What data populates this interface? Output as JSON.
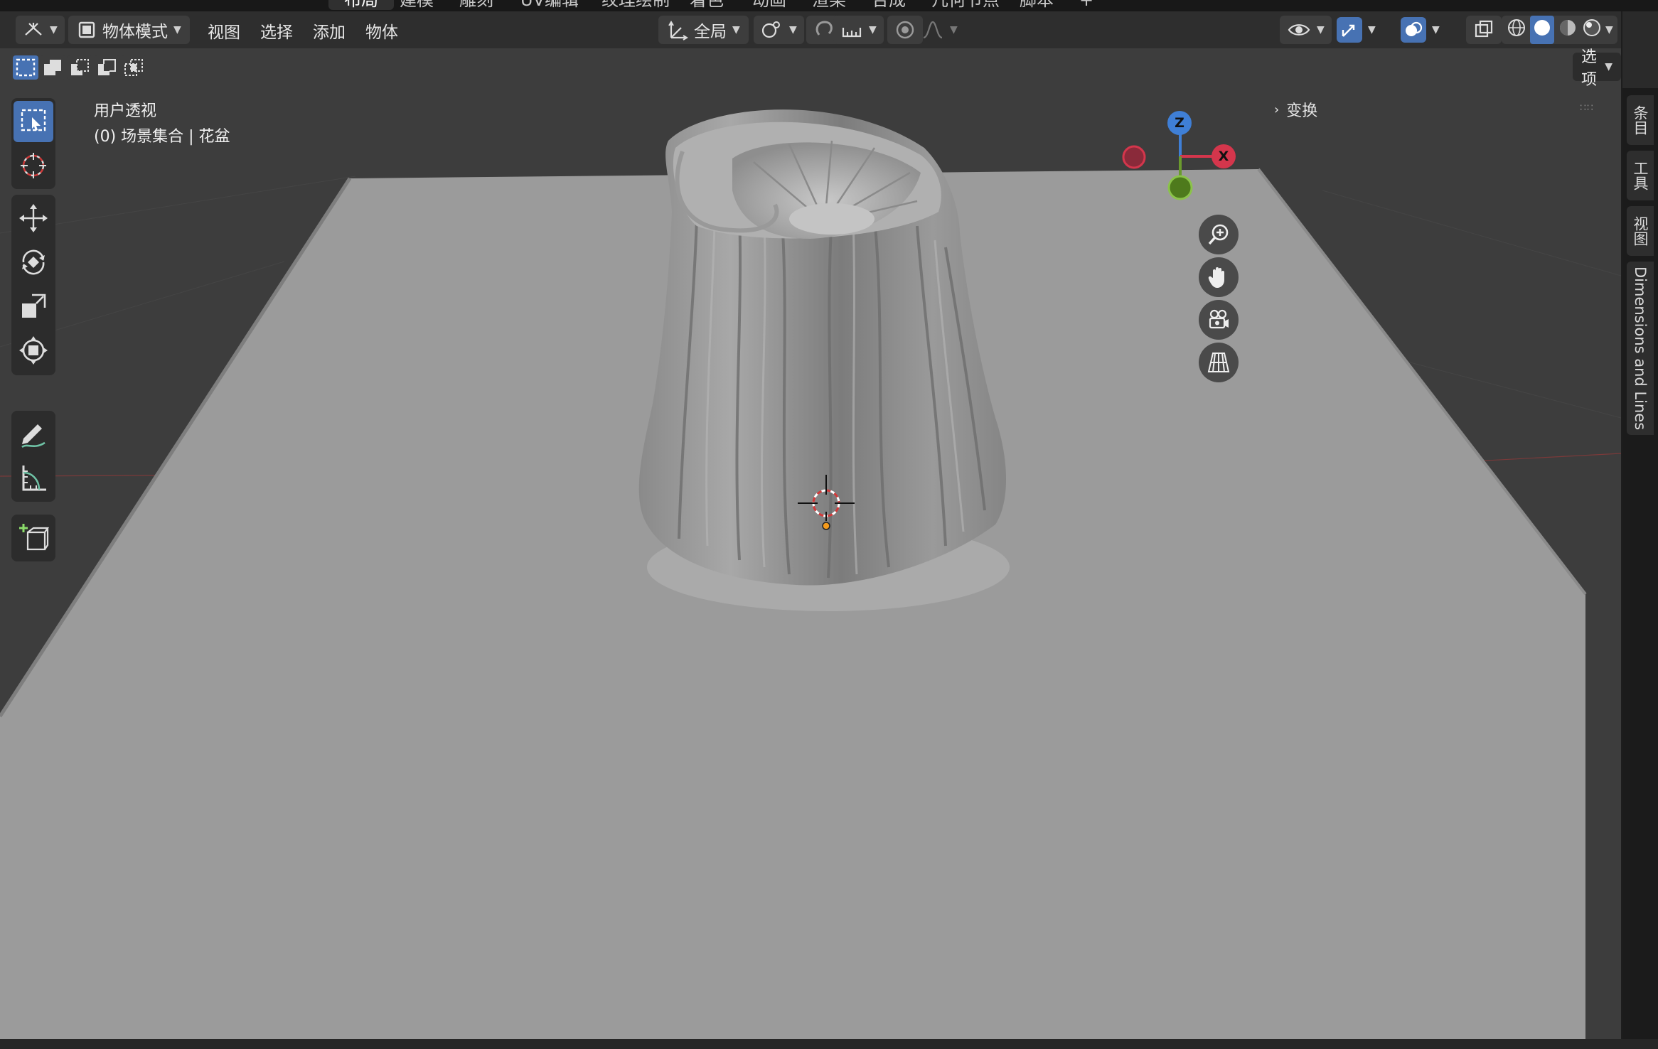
{
  "workspace_tabs": [
    "布局",
    "建模",
    "雕刻",
    "UV编辑",
    "纹理绘制",
    "着色",
    "动画",
    "渲染",
    "合成",
    "几何节点",
    "脚本"
  ],
  "active_tab": "布局",
  "header": {
    "mode": "物体模式",
    "menus": [
      "视图",
      "选择",
      "添加",
      "物体"
    ],
    "orientation": "全局"
  },
  "viewport": {
    "view_name": "用户透视",
    "collection_info": "(0) 场景集合 | 花盆",
    "options_label": "选项",
    "transform_label": "变换",
    "gizmo_axes": {
      "z": "Z",
      "x": "X"
    }
  },
  "side_tabs": [
    "条目",
    "工具",
    "视图",
    "Dimensions and Lines"
  ],
  "colors": {
    "accent": "#4772b3",
    "header_bg": "#2e2e2e",
    "viewport_bg": "#3d3d3d",
    "ground": "#9a9a9a",
    "axis_x": "#d4364c",
    "axis_y": "#6b9a2e",
    "axis_z": "#3f7fd6"
  },
  "icons": [
    "select-box-icon",
    "cursor-icon",
    "move-icon",
    "rotate-icon",
    "scale-icon",
    "transform-icon",
    "annotate-icon",
    "measure-icon",
    "add-cube-icon",
    "zoom-icon",
    "pan-hand-icon",
    "camera-icon",
    "grid-view-icon"
  ]
}
